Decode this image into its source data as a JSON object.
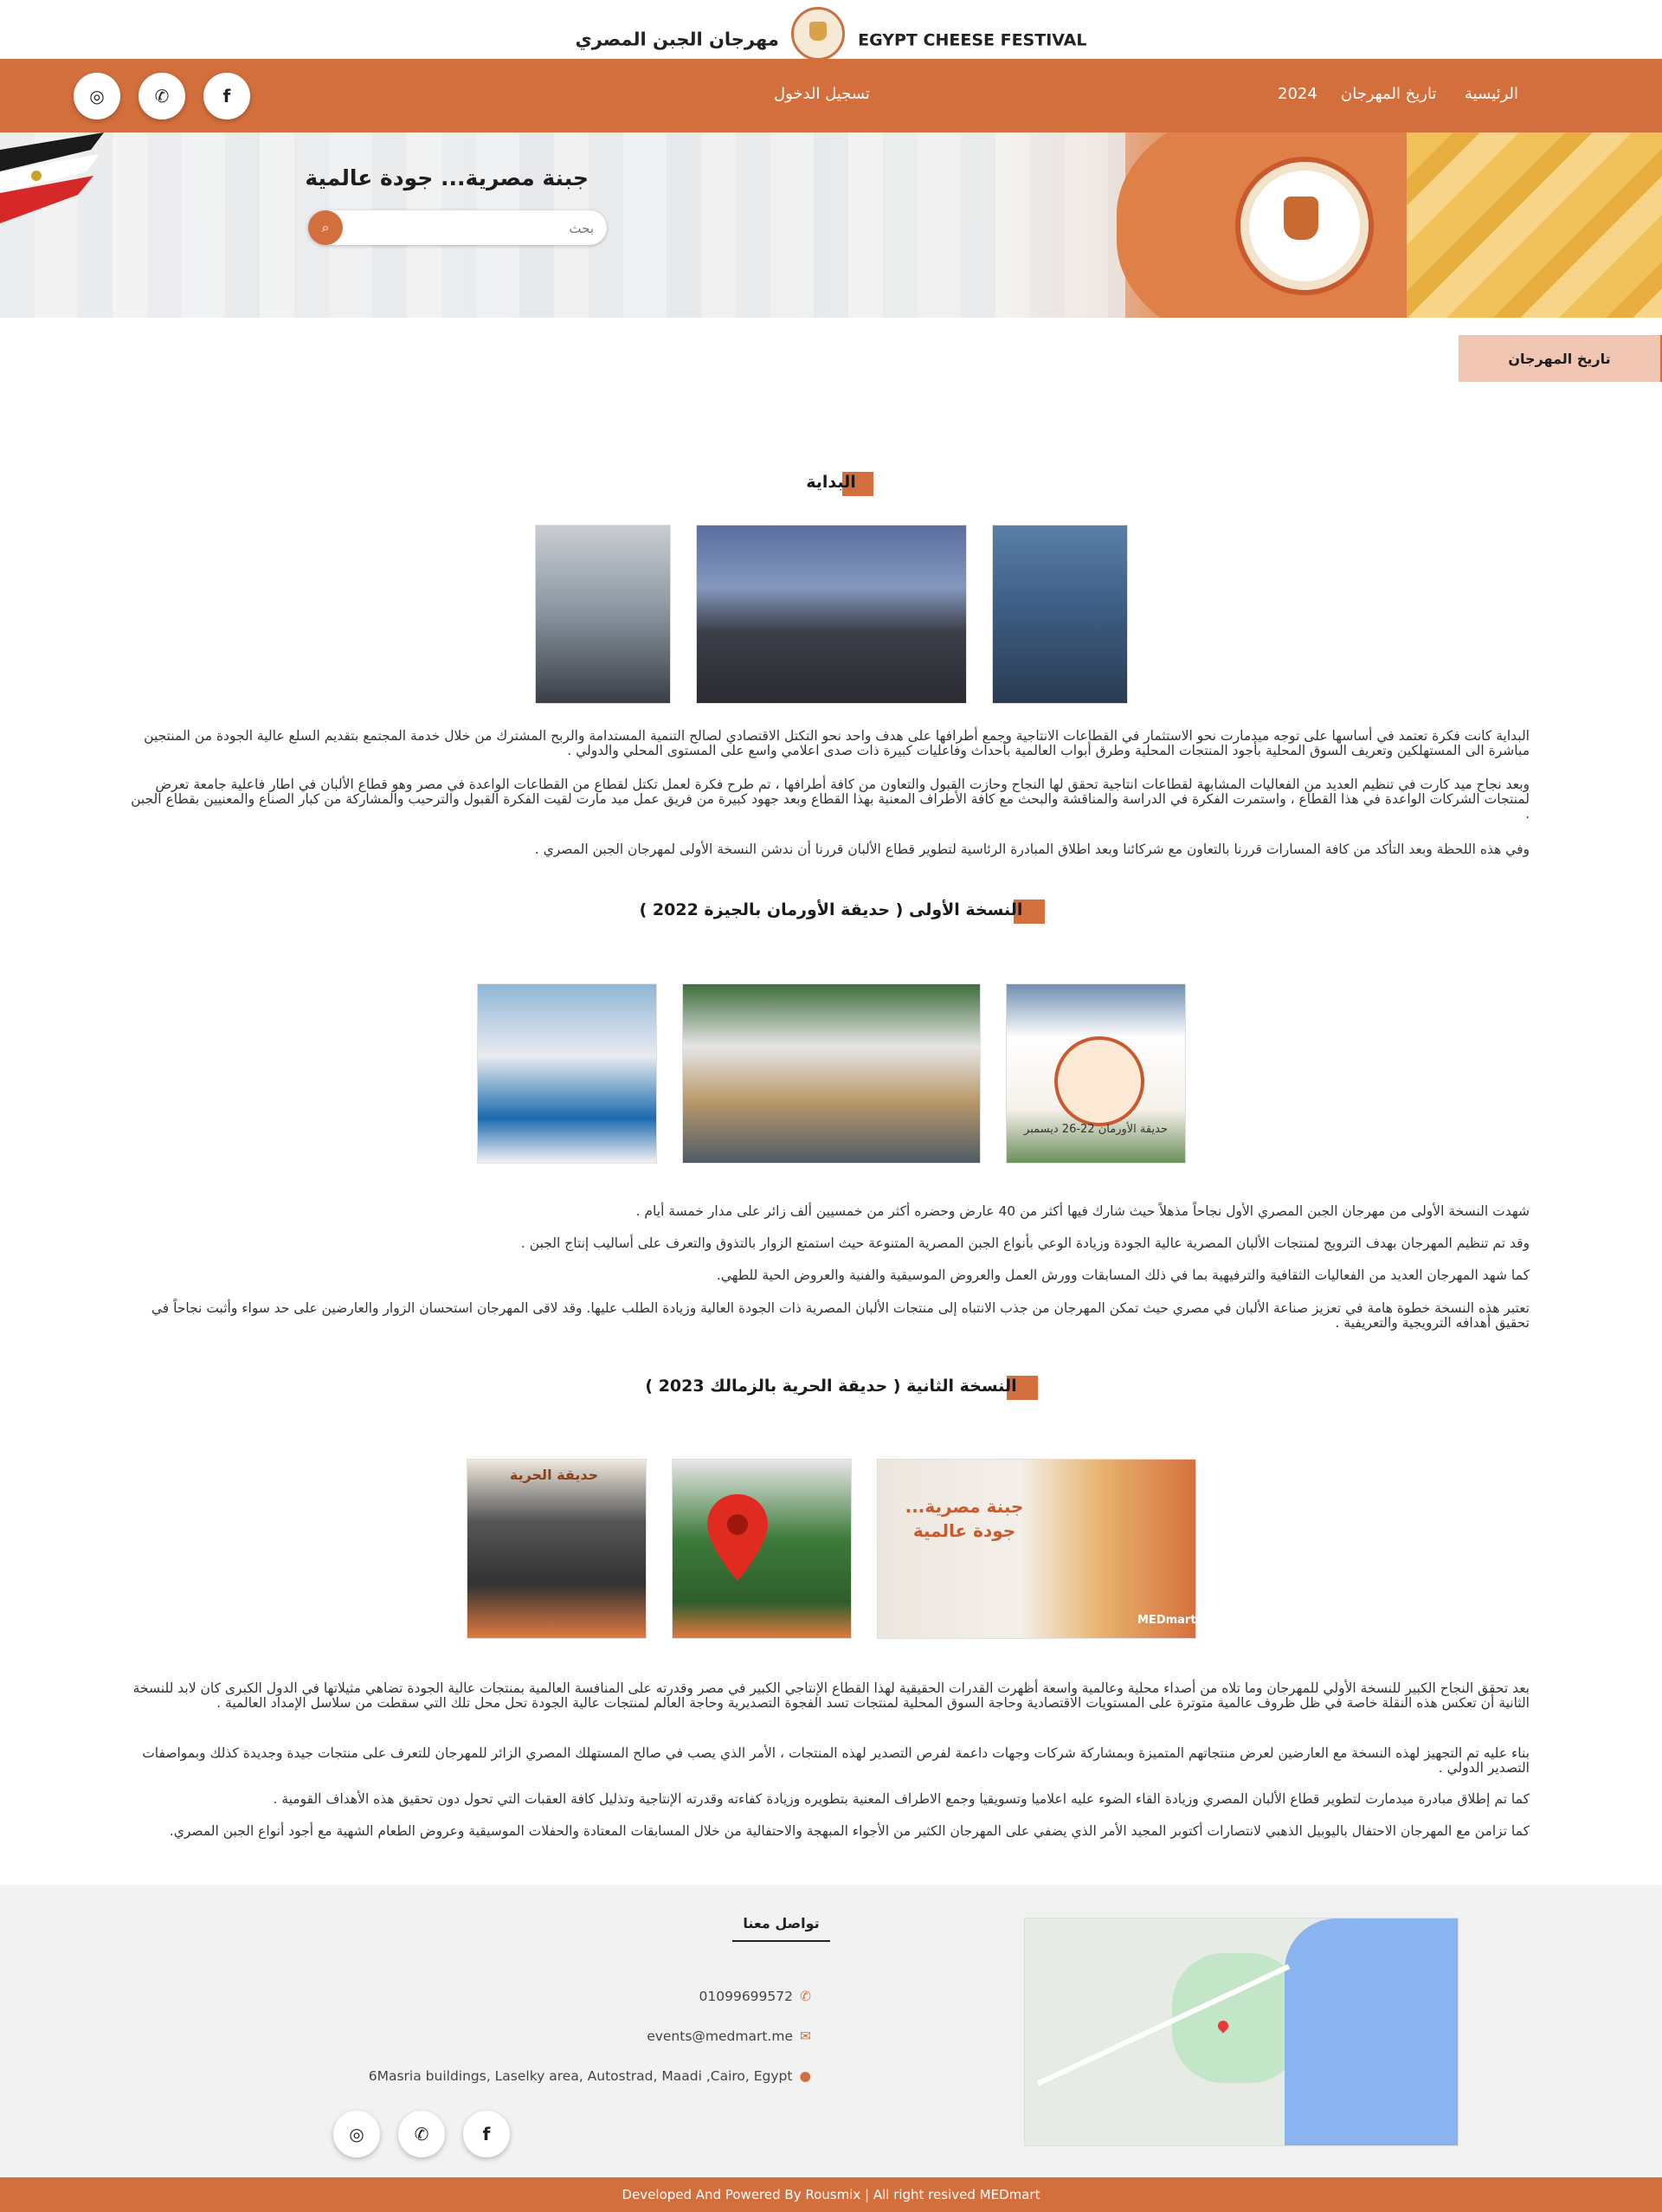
{
  "brand": {
    "name_en": "EGYPT CHEESE FESTIVAL",
    "name_ar": "مهرجان الجبن المصري"
  },
  "nav": {
    "links": [
      "الرئيسية",
      "تاريخ المهرجان",
      "2024"
    ],
    "login": "تسجيل الدخول",
    "social_icons": [
      "instagram-icon",
      "whatsapp-icon",
      "facebook-icon"
    ]
  },
  "hero": {
    "title": "جبنة مصرية... جودة عالمية",
    "search_placeholder": "بحث"
  },
  "tab": {
    "label": "تاريخ المهرجان"
  },
  "sections": {
    "beginning": {
      "title": "البداية",
      "paragraphs": [
        "البداية كانت فكرة تعتمد في أساسها على توجه ميدمارت نحو الاستثمار في القطاعات الانتاجية وجمع أطرافها على هدف واحد نحو التكتل الاقتصادي لصالح التنمية المستدامة والربح المشترك من خلال خدمة المجتمع بتقديم السلع عالية الجودة من المنتجين مباشرة الى المستهلكين وتعريف السوق المحلية بأجود المنتجات المحلية وطرق أبواب العالمية بأحداث وفاعليات كبيرة ذات صدى اعلامي واسع على المستوى المحلي والدولي .",
        "وبعد نجاح ميد كارت في تنظيم العديد من الفعاليات المشابهة لقطاعات انتاجية تحقق لها النجاح وحازت القبول والتعاون من كافة أطرافها ، تم طرح فكرة لعمل تكتل لقطاع من القطاعات الواعدة في مصر وهو قطاع الألبان في اطار فاعلية جامعة تعرض لمنتجات الشركات الواعدة في هذا القطاع ، واستمرت الفكرة في الدراسة والمناقشة والبحث مع كافة الأطراف المعنية بهذا القطاع وبعد جهود كبيرة من فريق عمل ميد مارت لقيت الفكرة القبول والترحيب والمشاركة من كبار الصناع والمعنيين بقطاع الجبن .",
        "وفي هذه اللحظة وبعد التأكد من كافة المسارات قررنا بالتعاون مع شركائنا وبعد اطلاق المبادرة الرئاسية لتطوير قطاع الألبان قررنا أن ندشن النسخة الأولى لمهرجان الجبن المصري ."
      ]
    },
    "first": {
      "title": "النسخة الأولى ( حديقة الأورمان بالجيزة 2022 )",
      "paragraphs": [
        "شهدت النسخة الأولى من مهرجان الجبن المصري الأول نجاحاً مذهلاً حيث شارك فيها أكثر من 40 عارض وحضره أكثر من خمسيين ألف زائر على مدار خمسة أيام .",
        "وقد تم تنظيم المهرجان بهدف الترويج لمنتجات الألبان المصرية عالية الجودة وزيادة الوعي بأنواع الجبن المصرية المتنوعة حيث استمتع الزوار بالتذوق والتعرف على أساليب إنتاج الجبن .",
        "كما شهد المهرجان العديد من الفعاليات الثقافية والترفيهية بما في ذلك المسابقات وورش العمل والعروض الموسيقية والفنية والعروض الحية للطهي.",
        "تعتبر هذه النسخة خطوة هامة في تعزيز صناعة الألبان في مصري حيث تمكن المهرجان من جذب الانتباه إلى منتجات الألبان المصرية ذات الجودة العالية وزيادة الطلب عليها. وقد لاقى المهرجان استحسان الزوار والعارضين على حد سواء وأثبت نجاحاً في تحقيق أهدافه الترويجية والتعريفية ."
      ]
    },
    "second": {
      "title": "النسخة الثانية ( حديقة الحرية بالزمالك 2023 )",
      "paragraphs": [
        "بعد تحقق النجاح الكبير للنسخة الأولي للمهرجان وما تلاه من أصداء محلية وعالمية واسعة أظهرت القدرات الحقيقية لهذا القطاع الإنتاجي الكبير في مصر وقدرته على المنافسة العالمية بمنتجات عالية الجودة تضاهي مثيلاتها في الدول الكبرى كان لابد للنسخة الثانية أن تعكس هذه النقلة خاصة في ظل ظروف عالمية متوترة على المستويات الاقتصادية وحاجة السوق المحلية لمنتجات تسد الفجوة التصديرية وحاجة العالم لمنتجات عالية الجودة تحل محل تلك التي سقطت من سلاسل الإمداد العالمية .",
        "بناء عليه تم التجهيز لهذه النسخة مع العارضين لعرض منتجاتهم المتميزة وبمشاركة شركات وجهات داعمة لفرص التصدير لهذه المنتجات ، الأمر الذي يصب في صالح المستهلك المصري الزائر للمهرجان للتعرف على منتجات جيدة وجديدة كذلك وبمواصفات التصدير الدولي .",
        "كما تم إطلاق مبادرة ميدمارت لتطوير قطاع الألبان المصري وزيادة القاء الضوء عليه اعلاميا وتسويقيا وجمع الاطراف المعنية بتطويره وزيادة كفاءته وقدرته الإنتاجية وتذليل كافة العقبات التي تحول دون تحقيق هذه الأهداف القومية .",
        "كما تزامن مع المهرجان الاحتفال باليوبيل الذهبي لانتصارات أكتوبر المجيد الأمر الذي يضفي على المهرجان الكثير من الأجواء المبهجة والاحتفالية من خلال المسابقات المعتادة والحفلات الموسيقية وعروض الطعام الشهية مع أجود أنواع الجبن المصري."
      ]
    }
  },
  "photo_text": {
    "flag_banner": "حديقة الأورمان 22-26 ديسمبر",
    "park_sign": "حديقة الحرية",
    "banner_title": "جبنة مصرية... جودة عالمية",
    "banner_brand": "MEDmart"
  },
  "footer": {
    "contact_title": "تواصل معنا",
    "phone": "01099699572",
    "email": "events@medmart.me",
    "address": "6Masria buildings, Laselky area, Autostrad, Maadi ,Cairo, Egypt",
    "copyright": "Developed And Powered By Rousmix | All right resived MEDmart"
  }
}
